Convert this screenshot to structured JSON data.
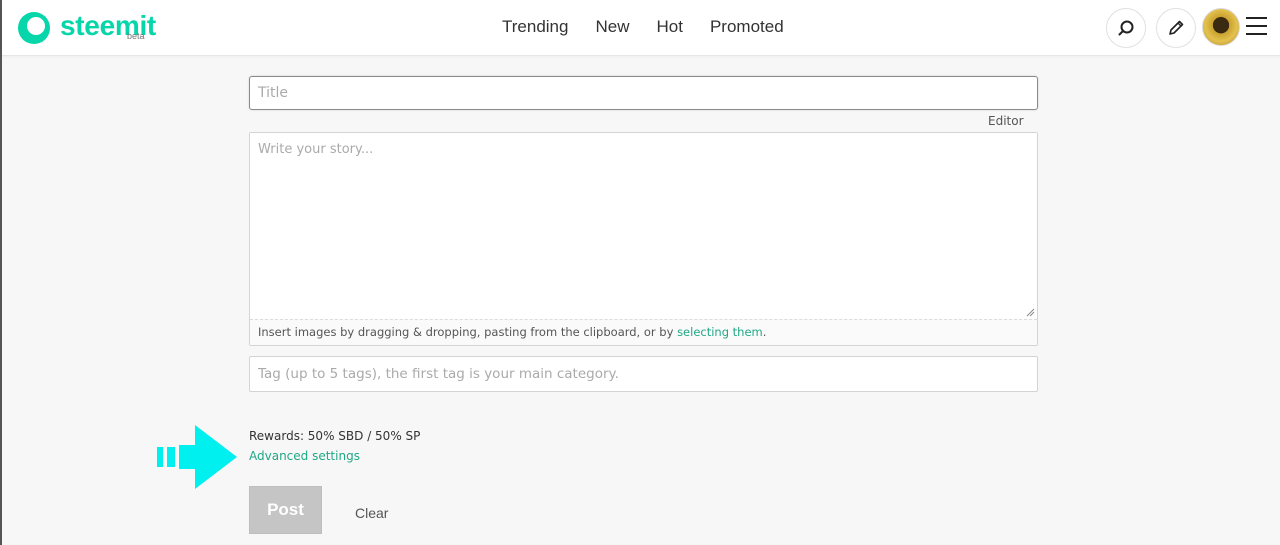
{
  "brand": {
    "name": "steemit",
    "badge": "beta",
    "color": "#06d6a9"
  },
  "nav": [
    {
      "label": "Trending"
    },
    {
      "label": "New"
    },
    {
      "label": "Hot"
    },
    {
      "label": "Promoted"
    }
  ],
  "header_icons": [
    "search-icon",
    "pencil-icon",
    "avatar",
    "hamburger-icon"
  ],
  "editor": {
    "title_placeholder": "Title",
    "mode_label": "Editor",
    "body_placeholder": "Write your story...",
    "dropzone_text": "Insert images by dragging & dropping, pasting from the clipboard, or by ",
    "dropzone_link": "selecting them",
    "dropzone_end": ".",
    "tags_placeholder": "Tag (up to 5 tags), the first tag is your main category."
  },
  "rewards": {
    "label": "Rewards: 50% SBD / 50% SP",
    "advanced_link": "Advanced settings"
  },
  "actions": {
    "post_label": "Post",
    "clear_label": "Clear"
  },
  "colors": {
    "accent": "#1fa886",
    "arrow": "#00f0f0"
  }
}
